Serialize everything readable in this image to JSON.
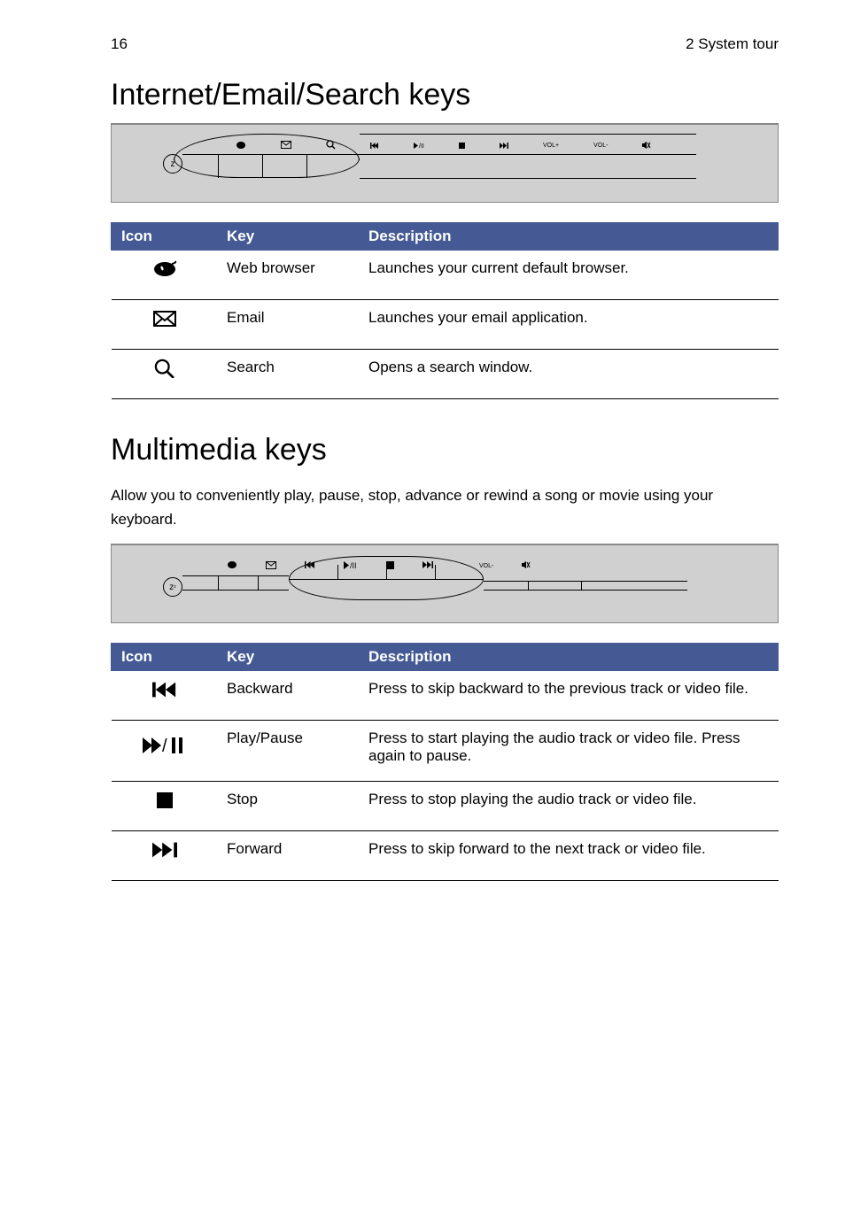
{
  "header": {
    "page": "16",
    "chapter": "2 System tour"
  },
  "section1": {
    "title": "Internet/Email/Search keys",
    "table": {
      "headers": [
        "Icon",
        "Key",
        "Description"
      ],
      "rows": [
        {
          "key": "Web browser",
          "desc": "Launches your current default browser."
        },
        {
          "key": "Email",
          "desc": "Launches your email application."
        },
        {
          "key": "Search",
          "desc": "Opens a search window."
        }
      ]
    }
  },
  "section2": {
    "title": "Multimedia keys",
    "intro": "Allow you to conveniently play, pause, stop, advance or rewind a song or movie using your keyboard.",
    "table": {
      "headers": [
        "Icon",
        "Key",
        "Description"
      ],
      "rows": [
        {
          "key": "Backward",
          "desc": "Press to skip backward to the previous track or video file."
        },
        {
          "key": "Play/Pause",
          "desc": "Press to start playing the audio track or video file. Press again to pause."
        },
        {
          "key": "Stop",
          "desc": "Press to stop playing the audio track or video file."
        },
        {
          "key": "Forward",
          "desc": "Press to skip forward to the next track or video file."
        }
      ]
    }
  },
  "kb_labels": {
    "vol_plus": "VOL+",
    "vol_minus": "VOL-"
  }
}
